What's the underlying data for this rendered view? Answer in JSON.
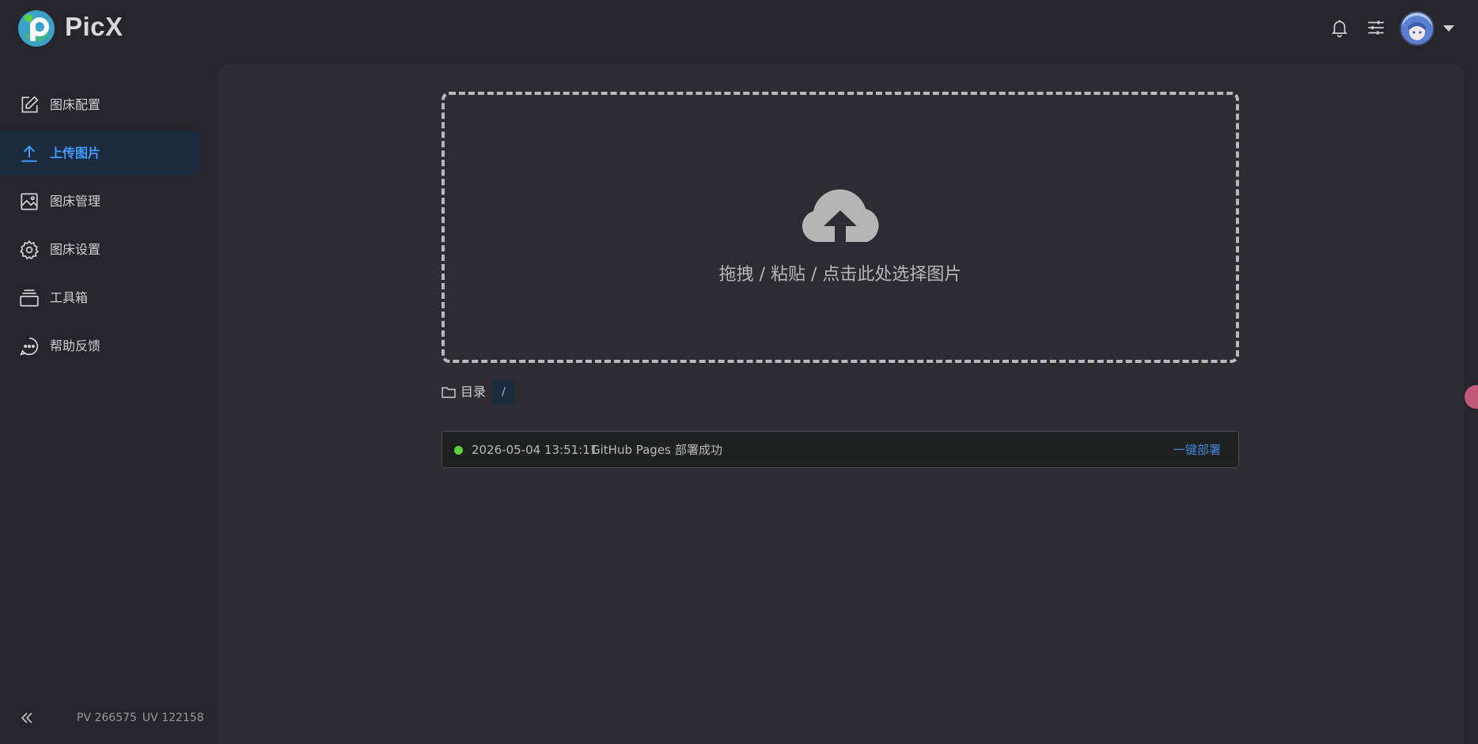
{
  "header": {
    "brand": "PicX",
    "icons": [
      "bell-icon",
      "sliders-icon",
      "avatar",
      "chevron-down-icon"
    ]
  },
  "sidebar": {
    "items": [
      {
        "label": "图床配置",
        "icon": "edit-icon",
        "active": false
      },
      {
        "label": "上传图片",
        "icon": "upload-icon",
        "active": true
      },
      {
        "label": "图床管理",
        "icon": "image-icon",
        "active": false
      },
      {
        "label": "图床设置",
        "icon": "gear-icon",
        "active": false
      },
      {
        "label": "工具箱",
        "icon": "toolbox-icon",
        "active": false
      },
      {
        "label": "帮助反馈",
        "icon": "chat-icon",
        "active": false
      }
    ],
    "stats": {
      "pv": "PV 266575",
      "uv": "UV 122158"
    }
  },
  "upload": {
    "hint": "拖拽 / 粘贴 / 点击此处选择图片"
  },
  "directory": {
    "label": "目录",
    "path": "/"
  },
  "deploy": {
    "time": "2026-05-04 13:51:11",
    "platform": "GitHub Pages",
    "status": "部署成功",
    "action": "一键部署"
  },
  "colors": {
    "accent": "#3f9bff",
    "success": "#5fd13a",
    "background": "#25252b",
    "panel": "#2c2c32"
  }
}
